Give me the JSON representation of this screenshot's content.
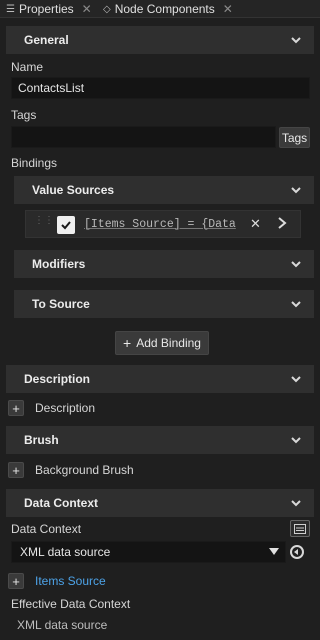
{
  "tabs": [
    {
      "label": "Properties",
      "icon": "list-icon"
    },
    {
      "label": "Node Components",
      "icon": "components-icon"
    }
  ],
  "sections": {
    "general": "General",
    "description": "Description",
    "brush": "Brush",
    "data_context": "Data Context"
  },
  "general": {
    "name_label": "Name",
    "name_value": "ContactsList",
    "tags_label": "Tags",
    "tags_value": "",
    "tags_button": "Tags",
    "bindings_label": "Bindings",
    "value_sources": "Value Sources",
    "binding_expr": "[Items Source] = {Data",
    "modifiers": "Modifiers",
    "to_source": "To Source",
    "add_binding": "Add Binding"
  },
  "description": {
    "add_label": "Description"
  },
  "brush": {
    "add_label": "Background Brush"
  },
  "data_context": {
    "field_label": "Data Context",
    "selected": "XML data source",
    "items_source": "Items Source",
    "effective_label": "Effective Data Context",
    "effective_value": "XML data source"
  },
  "colors": {
    "accent_link": "#4da3e8",
    "section_bg": "#2f2f2f",
    "panel_bg": "#1f1f1f"
  }
}
